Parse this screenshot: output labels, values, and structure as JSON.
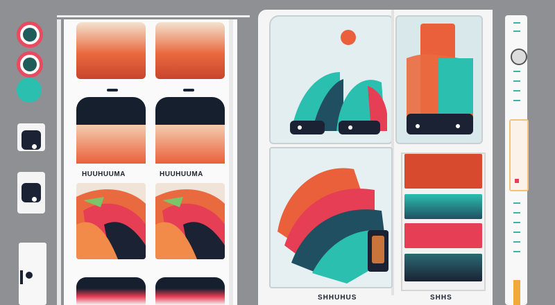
{
  "panel_a": {
    "column_label": "HUUHUUMA"
  },
  "panel_b": {
    "caption_left": "SHHUHUS",
    "caption_right": "SHHS"
  },
  "colors": {
    "accent_orange": "#e9603a",
    "accent_teal": "#2bbfb0",
    "accent_pink": "#e63e55",
    "dark_navy": "#161f2e"
  },
  "icons": [
    "toggle-icon",
    "toggle-icon",
    "knob-icon"
  ]
}
